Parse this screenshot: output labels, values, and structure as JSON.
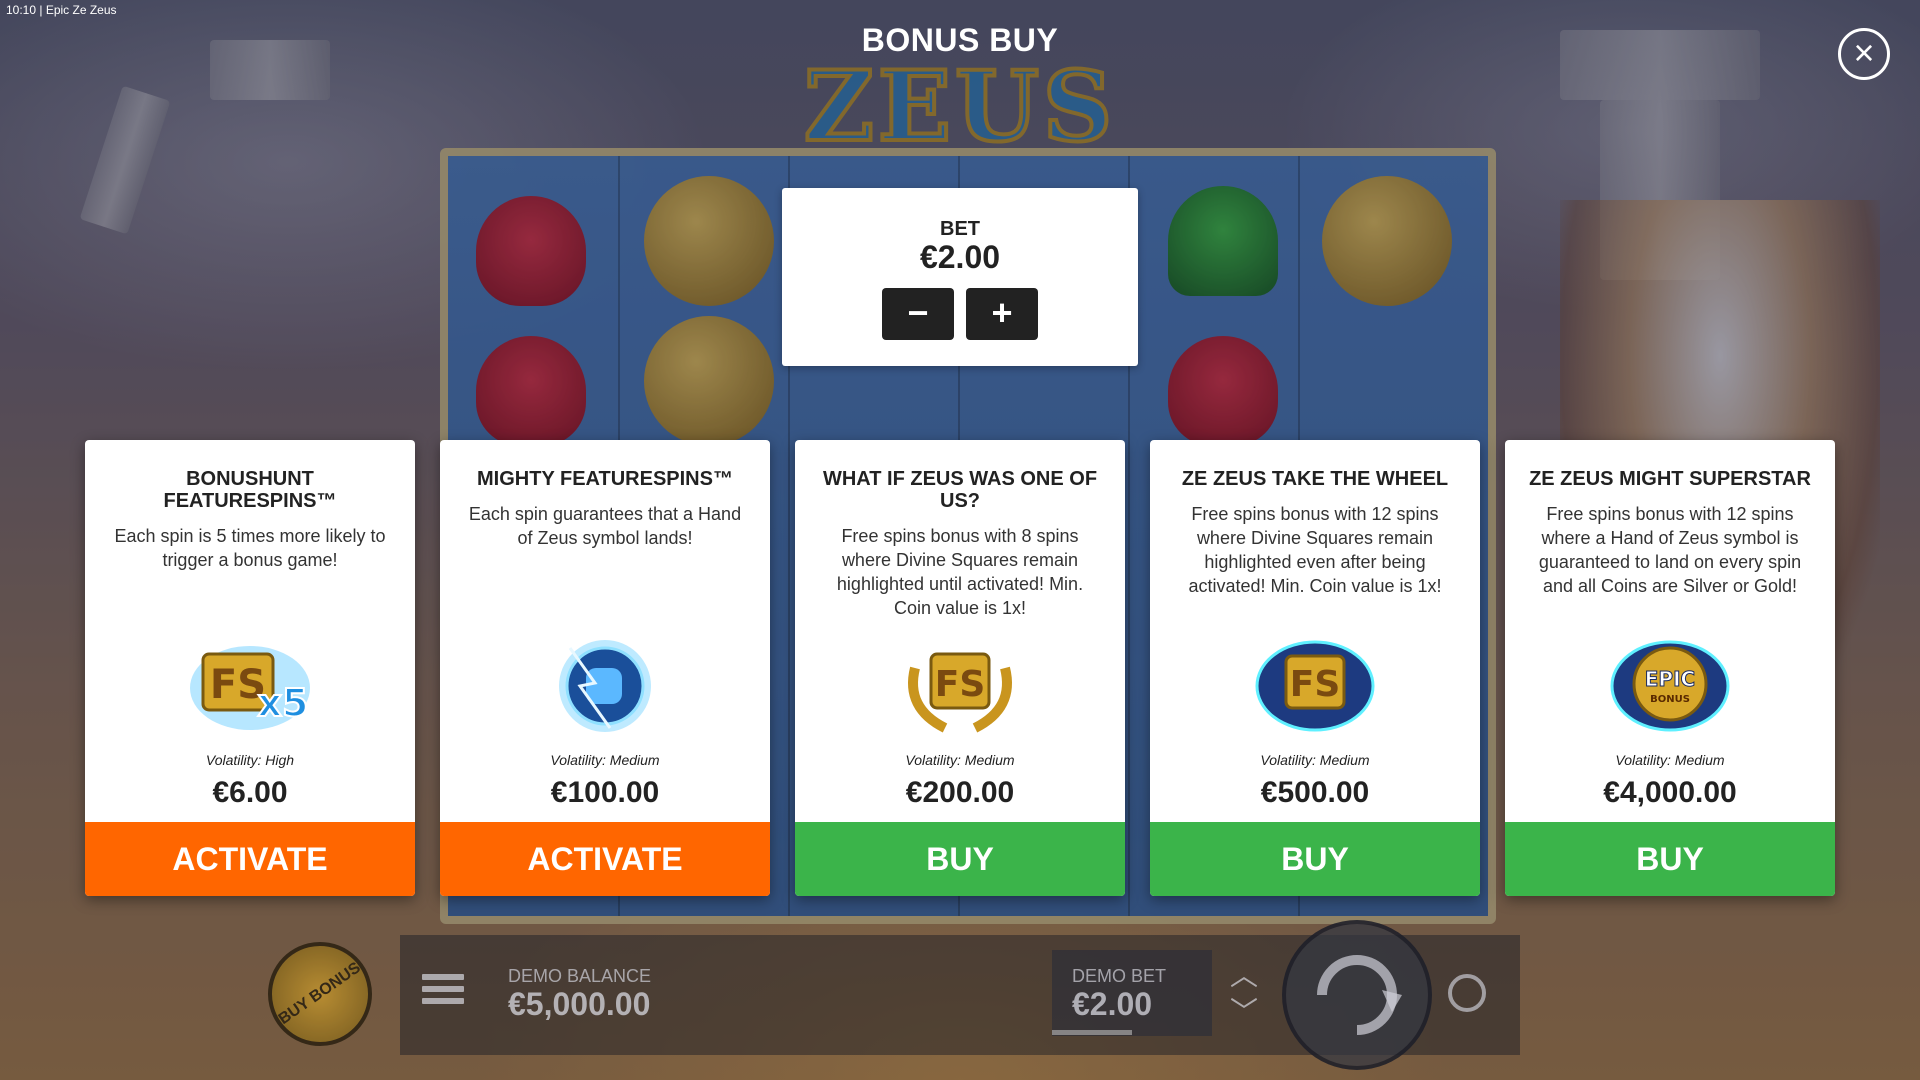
{
  "status_bar": {
    "time": "10:10",
    "app": "Epic Ze Zeus"
  },
  "header": {
    "title": "BONUS BUY",
    "logo_text": "ZEUS"
  },
  "bet": {
    "label": "BET",
    "value": "€2.00",
    "minus": "−",
    "plus": "+"
  },
  "cards": [
    {
      "title": "BONUSHUNT FEATURESPINS™",
      "description": "Each spin is 5 times more likely to trigger a bonus game!",
      "icon": "fs-x5-icon",
      "volatility": "Volatility: High",
      "price": "€6.00",
      "action": "ACTIVATE"
    },
    {
      "title": "MIGHTY FEATURESPINS™",
      "description": "Each spin guarantees that a Hand of Zeus symbol lands!",
      "icon": "hand-of-zeus-icon",
      "volatility": "Volatility: Medium",
      "price": "€100.00",
      "action": "ACTIVATE"
    },
    {
      "title": "WHAT IF ZEUS WAS ONE OF US?",
      "description": "Free spins bonus with 8 spins where Divine Squares remain highlighted until activated! Min. Coin value is 1x!",
      "icon": "fs-laurel-icon",
      "volatility": "Volatility: Medium",
      "price": "€200.00",
      "action": "BUY"
    },
    {
      "title": "ZE ZEUS TAKE THE WHEEL",
      "description": "Free spins bonus with 12 spins where Divine Squares remain highlighted even after being activated! Min. Coin value is 1x!",
      "icon": "fs-lightning-icon",
      "volatility": "Volatility: Medium",
      "price": "€500.00",
      "action": "BUY"
    },
    {
      "title": "ZE ZEUS MIGHT SUPERSTAR",
      "description": "Free spins bonus with 12 spins where a Hand of Zeus symbol is guaranteed to land on every spin and all Coins are Silver or Gold!",
      "icon": "epic-bonus-icon",
      "icon_text": "EPIC",
      "icon_subtext": "BONUS",
      "volatility": "Volatility: Medium",
      "price": "€4,000.00",
      "action": "BUY"
    }
  ],
  "footer": {
    "buy_bonus": "BUY BONUS",
    "balance_label": "DEMO BALANCE",
    "balance_value": "€5,000.00",
    "bet_label": "DEMO BET",
    "bet_value": "€2.00"
  },
  "colors": {
    "activate": "#ff6600",
    "buy": "#3bb44a"
  }
}
